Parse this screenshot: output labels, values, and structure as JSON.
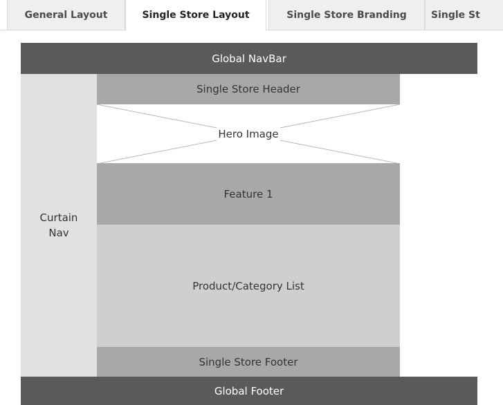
{
  "tabs": [
    {
      "label": "General Layout",
      "active": false
    },
    {
      "label": "Single Store Layout",
      "active": true
    },
    {
      "label": "Single Store Branding",
      "active": false
    },
    {
      "label": "Single St",
      "active": false
    }
  ],
  "diagram": {
    "global_navbar": "Global NavBar",
    "curtain_nav": "Curtain\nNav",
    "single_store_header": "Single Store Header",
    "hero_image": "Hero Image",
    "feature_1": "Feature 1",
    "product_category_list": "Product/Category List",
    "single_store_footer": "Single Store Footer",
    "global_footer": "Global Footer"
  },
  "colors": {
    "dark_bar": "#5a5a5a",
    "medium_block": "#a8a8a8",
    "light_block": "#cfcfcf",
    "curtain": "#e1e1e1"
  }
}
